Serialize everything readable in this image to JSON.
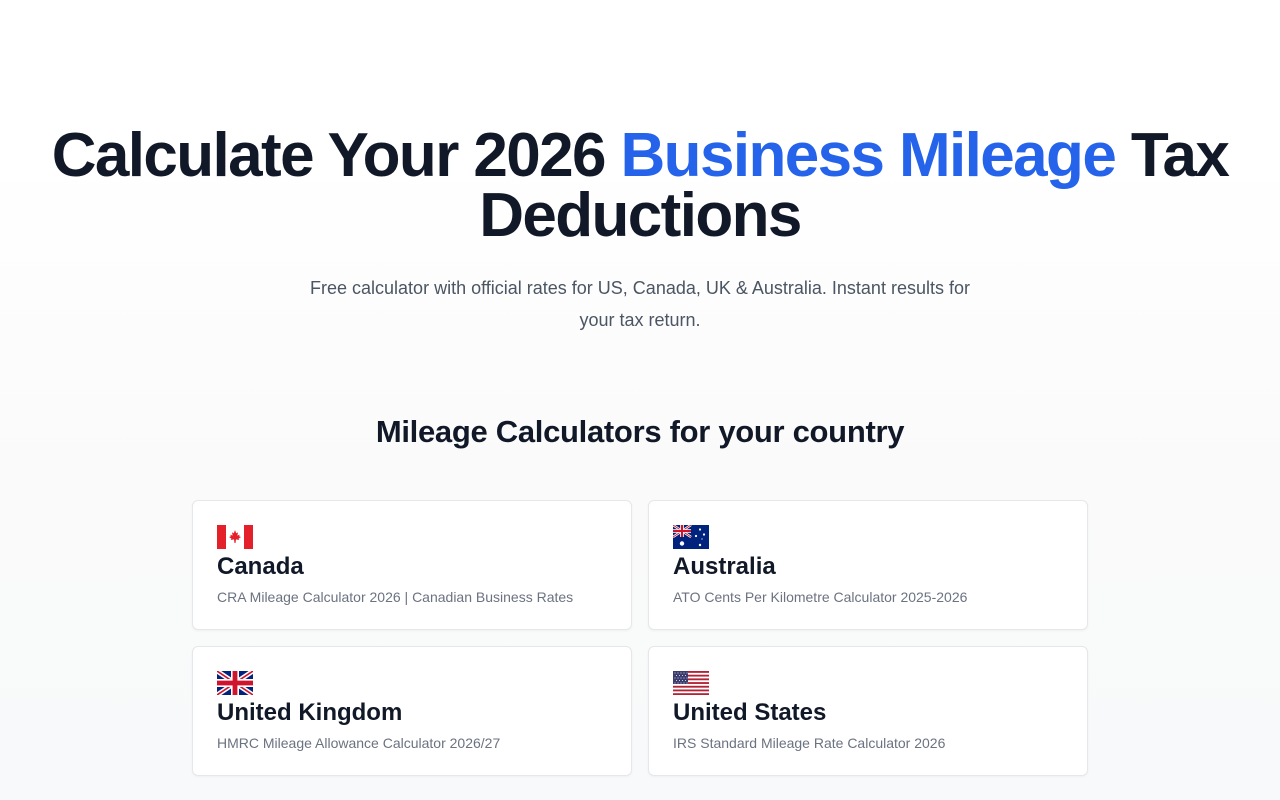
{
  "hero": {
    "headline_pre": "Calculate Your 2026 ",
    "headline_accent": "Business Mileage",
    "headline_post": " Tax Deductions",
    "subtitle": "Free calculator with official rates for US, Canada, UK & Australia. Instant results for your tax return.",
    "accent_color": "#2563eb"
  },
  "section": {
    "title": "Mileage Calculators for your country"
  },
  "countries": [
    {
      "name": "Canada",
      "description": "CRA Mileage Calculator 2026 | Canadian Business Rates",
      "flag_icon": "canada-flag-icon"
    },
    {
      "name": "Australia",
      "description": "ATO Cents Per Kilometre Calculator 2025-2026",
      "flag_icon": "australia-flag-icon"
    },
    {
      "name": "United Kingdom",
      "description": "HMRC Mileage Allowance Calculator 2026/27",
      "flag_icon": "uk-flag-icon"
    },
    {
      "name": "United States",
      "description": "IRS Standard Mileage Rate Calculator 2026",
      "flag_icon": "us-flag-icon"
    }
  ]
}
